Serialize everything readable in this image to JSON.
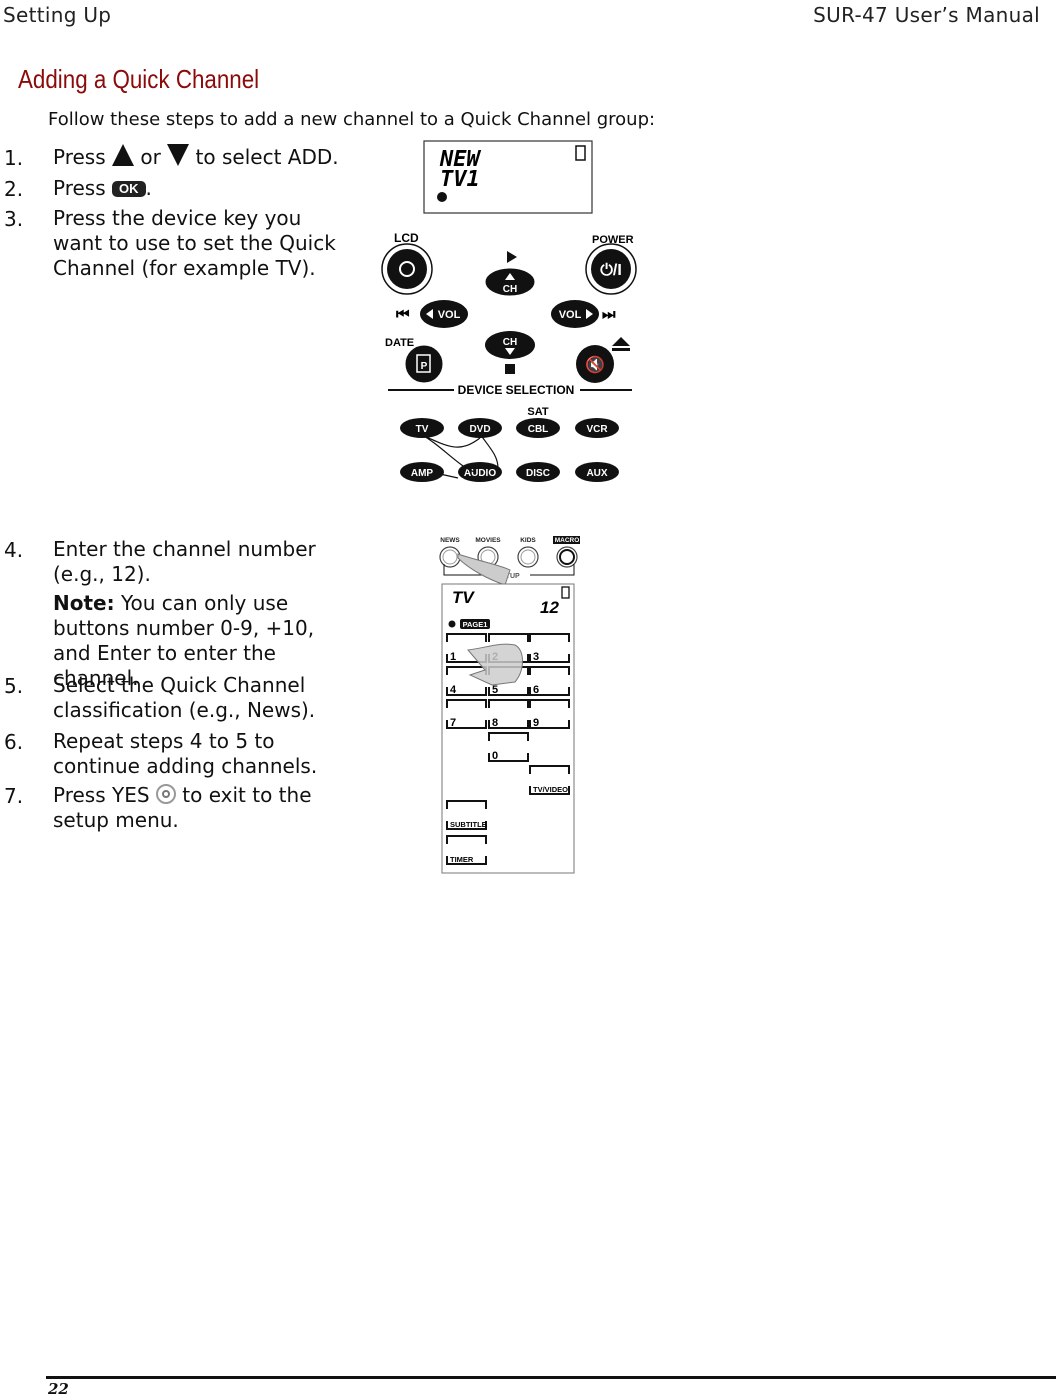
{
  "header": {
    "section": "Setting Up",
    "manual": "SUR-47 User’s Manual"
  },
  "title": "Adding a Quick Channel",
  "intro": "Follow these steps to add a new channel to a Quick Channel group:",
  "steps": [
    {
      "num": "1.",
      "pre": "Press",
      "mid": "or",
      "post": "to select",
      "bold": "ADD",
      "end": "."
    },
    {
      "num": "2.",
      "pre": "Press",
      "button": "OK",
      "end": "."
    },
    {
      "num": "3.",
      "text": "Press the device key you want to use to set the Quick Channel (for example TV)."
    },
    {
      "num": "4.",
      "text": "Enter the channel number (e.g., 12).",
      "note_label": "Note:",
      "note": " You can only use buttons number 0-9, +10, and Enter to enter the channel."
    },
    {
      "num": "5.",
      "text": "Select the Quick Channel classification (e.g., News)."
    },
    {
      "num": "6.",
      "text": "Repeat steps 4 to 5 to continue adding channels."
    },
    {
      "num": "7.",
      "pre": "Press YES",
      "post": "to exit to the setup menu."
    }
  ],
  "figure1": {
    "lcd_line1": "NEW",
    "lcd_line2": "TV1",
    "lcd_label": "LCD",
    "power_label": "POWER",
    "date_label": "DATE",
    "ch": "CH",
    "vol": "VOL",
    "device_selection": "DEVICE SELECTION",
    "sat": "SAT",
    "devices": [
      "TV",
      "DVD",
      "CBL",
      "VCR",
      "AMP",
      "AUDIO",
      "DISC",
      "AUX"
    ]
  },
  "figure2": {
    "quick": [
      "NEWS",
      "MOVIES",
      "KIDS",
      "MACRO"
    ],
    "setup": "SETUP",
    "lcd_device": "TV",
    "lcd_channel": "12",
    "page": "PAGE1",
    "digits": [
      "1",
      "2",
      "3",
      "4",
      "5",
      "6",
      "7",
      "8",
      "9",
      "0"
    ],
    "tvvideo": "TV/VIDEO",
    "subtitle": "SUBTITLE",
    "timer": "TIMER"
  },
  "footer": {
    "page": "22"
  }
}
